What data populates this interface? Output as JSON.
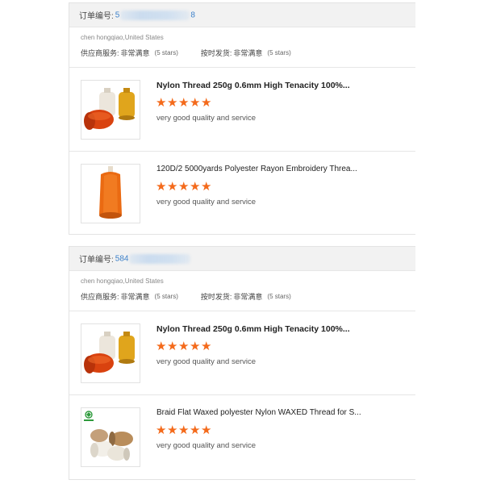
{
  "orders": [
    {
      "order_label": "订单编号:",
      "order_prefix": "5",
      "order_suffix": "8",
      "buyer": "chen hongqiao,United States",
      "supplier_service_label": "供应商服务:",
      "supplier_service_value": "非常满意",
      "supplier_service_note": "(5 stars)",
      "delivery_label": "按时发货:",
      "delivery_value": "非常满意",
      "delivery_note": "(5 stars)",
      "items": [
        {
          "title": "Nylon Thread 250g 0.6mm High Tenacity 100%...",
          "stars": 5,
          "review": "very good quality and service"
        },
        {
          "title": "120D/2 5000yards Polyester Rayon Embroidery Threa...",
          "stars": 5,
          "review": "very good quality and service"
        }
      ]
    },
    {
      "order_label": "订单编号:",
      "order_prefix": "584",
      "order_suffix": "",
      "buyer": "chen hongqiao,United States",
      "supplier_service_label": "供应商服务:",
      "supplier_service_value": "非常满意",
      "supplier_service_note": "(5 stars)",
      "delivery_label": "按时发货:",
      "delivery_value": "非常满意",
      "delivery_note": "(5 stars)",
      "items": [
        {
          "title": "Nylon Thread 250g 0.6mm High Tenacity 100%...",
          "stars": 5,
          "review": "very good quality and service"
        },
        {
          "title": "Braid Flat Waxed polyester Nylon WAXED Thread for S...",
          "stars": 5,
          "review": "very good quality and service"
        }
      ]
    }
  ],
  "icons": {
    "star": "star-icon"
  },
  "colors": {
    "star": "#f46a1b",
    "order_number": "#3a7fc9",
    "header_bg": "#f2f2f2"
  }
}
